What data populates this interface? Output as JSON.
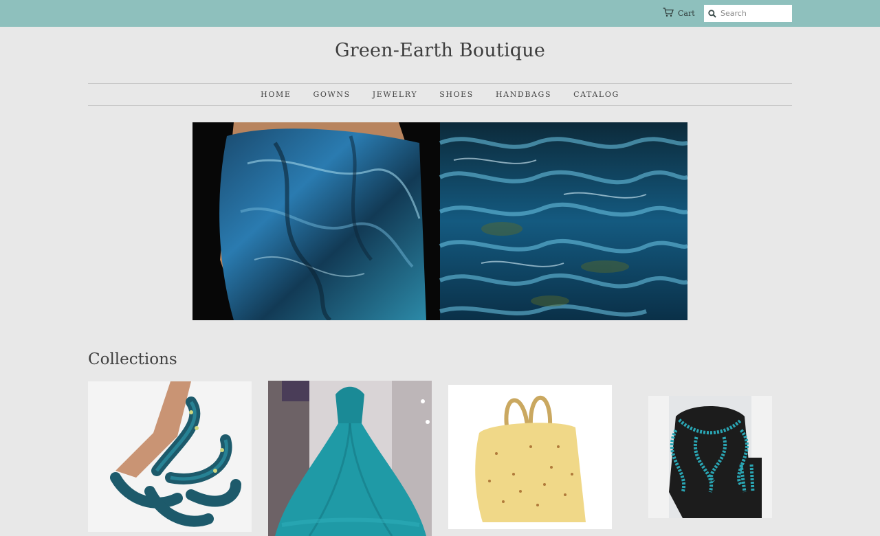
{
  "topbar": {
    "cart_label": "Cart",
    "search_placeholder": "Search",
    "bg_color": "#8ec0bd"
  },
  "site": {
    "title": "Green-Earth Boutique"
  },
  "nav": {
    "items": [
      {
        "label": "HOME"
      },
      {
        "label": "GOWNS"
      },
      {
        "label": "JEWELRY"
      },
      {
        "label": "SHOES"
      },
      {
        "label": "HANDBAGS"
      },
      {
        "label": "CATALOG"
      }
    ]
  },
  "hero": {
    "image_icon": "hero-banner-image"
  },
  "collections": {
    "heading": "Collections",
    "items": [
      {
        "icon": "octopus-shoe-image"
      },
      {
        "icon": "teal-gown-image"
      },
      {
        "icon": "cheese-handbag-image"
      },
      {
        "icon": "octopus-necklace-image"
      }
    ]
  }
}
